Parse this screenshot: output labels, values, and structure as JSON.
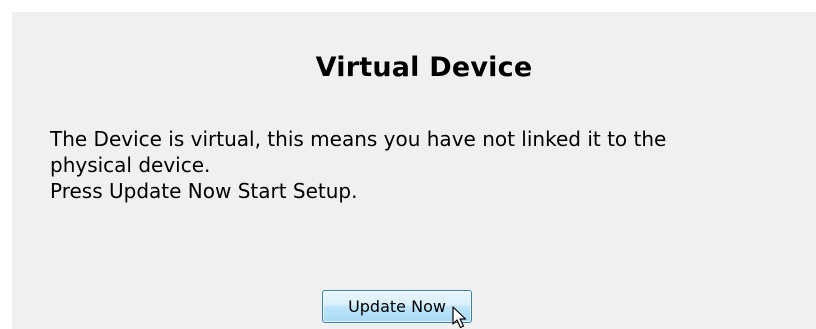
{
  "dialog": {
    "title": "Virtual Device",
    "message_lines": [
      "The Device is virtual, this means you have not linked it to the",
      "physical device.",
      "Press Update Now Start Setup."
    ],
    "update_button_label": "Update Now"
  },
  "icons": {
    "cursor": "mouse-pointer-icon"
  },
  "colors": {
    "panel_background": "#f0f0f0",
    "button_border": "#3c7fb1",
    "button_fill": "#bee6fd"
  }
}
